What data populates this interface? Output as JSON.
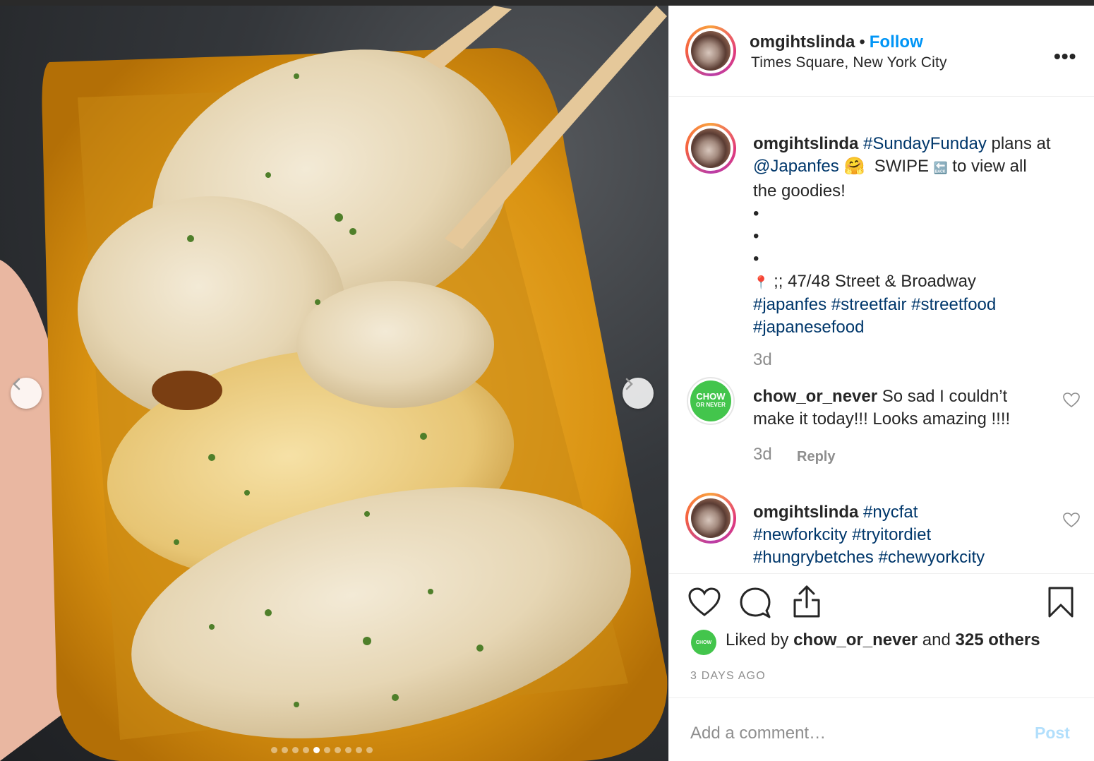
{
  "post": {
    "username": "omgihtslinda",
    "follow_label": "Follow",
    "separator": "•",
    "location": "Times Square, New York City",
    "more_label": "•••"
  },
  "caption": {
    "username": "omgihtslinda",
    "hashtag1": "#SundayFunday",
    "text1": " plans at",
    "mention": "@Japanfes",
    "emoji": "🤗",
    "swipe": "SWIPE",
    "back_emoji": "🔙",
    "text2": "to view all",
    "text3": "the goodies!",
    "bullets": [
      "•",
      "•",
      "•"
    ],
    "pin_emoji": "📍",
    "address": " ;; 47/48 Street & Broadway",
    "tags": [
      "#japanfes",
      "#streetfair",
      "#streetfood",
      "#japanesefood"
    ],
    "time": "3d"
  },
  "comments": [
    {
      "username": "chow_or_never",
      "text": "So sad I couldn’t make it today!!! Looks amazing !!!!",
      "time": "3d",
      "reply_label": "Reply",
      "avatar_text": "CHOW",
      "avatar_sub": "OR NEVER"
    },
    {
      "username": "omgihtslinda",
      "tags": [
        "#nycfat",
        "#newforkcity",
        "#tryitordiet",
        "#hungrybetches",
        "#chewyorkcity"
      ]
    }
  ],
  "actions": {
    "like_icon": "heart-icon",
    "comment_icon": "comment-icon",
    "share_icon": "share-icon",
    "save_icon": "bookmark-icon"
  },
  "likes": {
    "prefix": "Liked by ",
    "user": "chow_or_never",
    "and": " and ",
    "others": "325 others"
  },
  "timestamp": "3 DAYS AGO",
  "add_comment": {
    "placeholder": "Add a comment…",
    "post_label": "Post"
  },
  "carousel": {
    "total": 10,
    "active_index": 4
  },
  "colors": {
    "link_blue": "#0095f6",
    "hashtag": "#00376b",
    "muted": "#8e8e8e",
    "chow_green": "#43c54c"
  }
}
